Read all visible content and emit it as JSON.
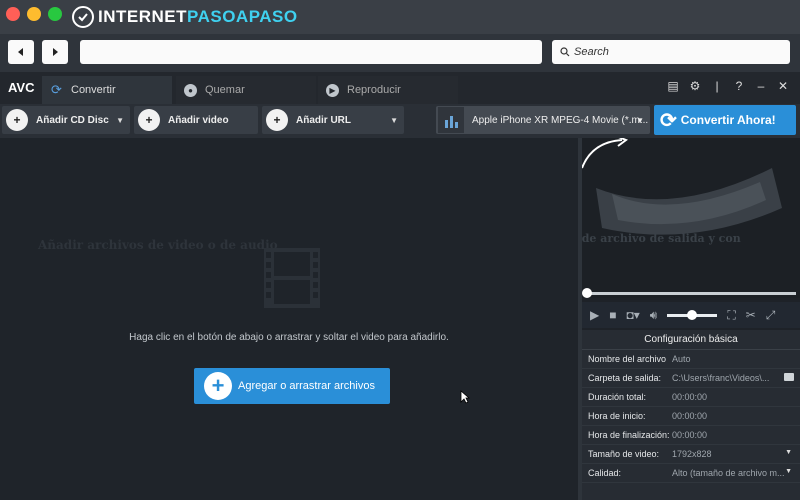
{
  "browser": {
    "logo_prefix": "INTERNET",
    "logo_accent": "PASOAPASO",
    "search_placeholder": "Search"
  },
  "app": {
    "name": "AVC",
    "tabs": [
      {
        "label": "Convertir",
        "active": true
      },
      {
        "label": "Quemar"
      },
      {
        "label": "Reproducir"
      }
    ],
    "actions": {
      "add_cd": "Añadir CD Disc",
      "add_video": "Añadir video",
      "add_url": "Añadir URL",
      "format": "Apple iPhone XR MPEG-4 Movie (*.m...",
      "convert": "Convertir Ahora!"
    },
    "main": {
      "ghost_title": "Añadir archivos de video o de audio",
      "hint": "Haga clic en el botón de abajo o arrastrar y soltar el video para añadirlo.",
      "add_button": "Agregar o arrastrar archivos"
    },
    "preview": {
      "ghost_text": "Seleccione el formato de archivo de salida y con"
    },
    "config": {
      "title": "Configuración básica",
      "rows": [
        {
          "key": "Nombre del archivo",
          "value": "Auto"
        },
        {
          "key": "Carpeta de salida:",
          "value": "C:\\Users\\franc\\Videos\\..."
        },
        {
          "key": "Duración total:",
          "value": "00:00:00"
        },
        {
          "key": "Hora de inicio:",
          "value": "00:00:00"
        },
        {
          "key": "Hora de finalización:",
          "value": "00:00:00"
        },
        {
          "key": "Tamaño de video:",
          "value": "1792x828"
        },
        {
          "key": "Calidad:",
          "value": "Alto (tamaño de archivo m..."
        }
      ]
    },
    "colors": {
      "accent": "#2a8fd8",
      "background": "#1f242a"
    }
  }
}
